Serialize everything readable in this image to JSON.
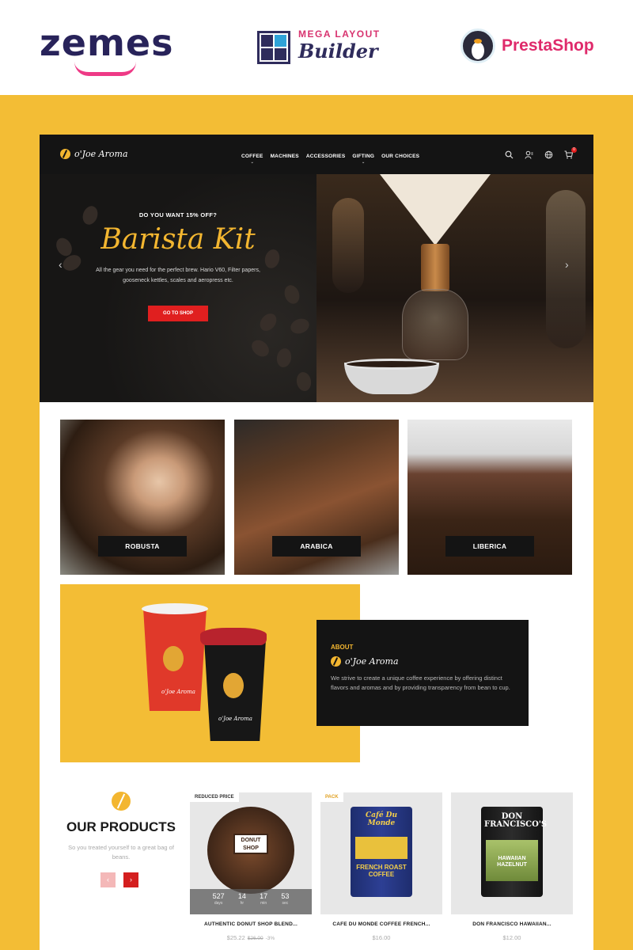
{
  "banner": {
    "zemes_logo": "zemes",
    "mega_line1": "MEGA LAYOUT",
    "mega_line2": "Builder",
    "presta_logo": "PrestaShop"
  },
  "site": {
    "brand": "o'Joe Aroma",
    "nav": [
      "COFFEE",
      "MACHINES",
      "ACCESSORIES",
      "GIFTING",
      "OUR CHOICES"
    ],
    "nav_has_dropdown": [
      true,
      false,
      false,
      true,
      false
    ],
    "cart_count": "0",
    "icons": [
      "search-icon",
      "user-icon",
      "globe-icon",
      "cart-icon"
    ]
  },
  "hero": {
    "eyebrow": "DO YOU WANT 15% OFF?",
    "title": "Barista Kit",
    "text": "All the gear you need for the perfect brew. Hario V60, Filter papers, gooseneck kettles, scales and aeropress etc.",
    "button": "GO TO SHOP",
    "prev_arrow": "‹",
    "next_arrow": "›"
  },
  "categories": [
    {
      "label": "ROBUSTA"
    },
    {
      "label": "ARABICA"
    },
    {
      "label": "LIBERICA"
    }
  ],
  "about": {
    "eyebrow": "ABOUT",
    "brand": "o'Joe Aroma",
    "text": "We strive to create a unique coffee experience by offering distinct flavors and aromas and by providing transparency from bean to cup.",
    "cup_brand_1": "o'Joe Aroma",
    "cup_brand_2": "o'Joe Aroma"
  },
  "products_section": {
    "title": "OUR PRODUCTS",
    "subtitle": "So you treated yourself to a great bag of beans.",
    "prev": "‹",
    "next": "›"
  },
  "products": [
    {
      "tag": "REDUCED PRICE",
      "name": "AUTHENTIC DONUT SHOP BLEND...",
      "price": "$25.22",
      "old_price": "$26.00",
      "discount": "-3%",
      "image_label": "DONUT SHOP",
      "countdown": [
        {
          "num": "527",
          "label": "days"
        },
        {
          "num": "14",
          "label": "hr"
        },
        {
          "num": "17",
          "label": "min"
        },
        {
          "num": "53",
          "label": "sec"
        }
      ]
    },
    {
      "tag": "PACK",
      "name": "CAFE DU MONDE COFFEE FRENCH...",
      "price": "$16.00",
      "image_top": "Café Du Monde",
      "image_bottom": "FRENCH ROAST COFFEE"
    },
    {
      "name": "DON FRANCISCO HAWAIIAN...",
      "price": "$12.00",
      "image_top": "DON FRANCISCO'S",
      "image_bottom": "HAWAIIAN HAZELNUT"
    }
  ],
  "colors": {
    "background_yellow": "#f3bd35",
    "dark": "#141414",
    "accent_red": "#e01f1f",
    "gold": "#f3b630"
  }
}
